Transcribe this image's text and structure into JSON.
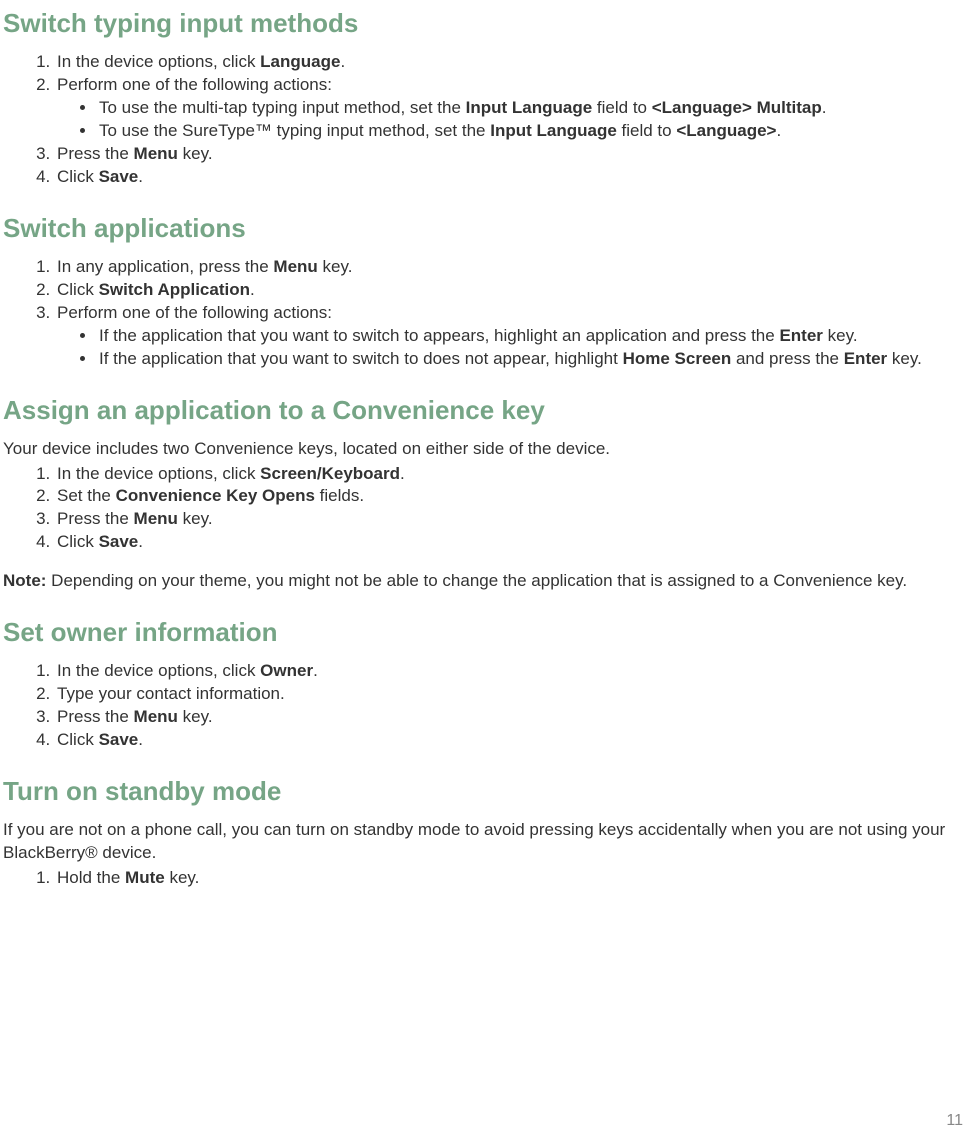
{
  "page_number": "11",
  "sections": {
    "s1": {
      "heading": "Switch typing input methods",
      "li1_a": "In the device options, click ",
      "li1_b": "Language",
      "li1_c": ".",
      "li2": "Perform one of the following actions:",
      "li2_sub1_a": "To use the multi-tap typing input method, set the ",
      "li2_sub1_b": "Input Language",
      "li2_sub1_c": " field to ",
      "li2_sub1_d": "<Language> Multitap",
      "li2_sub1_e": ".",
      "li2_sub2_a": "To use the SureType™ typing input method, set the ",
      "li2_sub2_b": "Input Language",
      "li2_sub2_c": " field to ",
      "li2_sub2_d": "<Language>",
      "li2_sub2_e": ".",
      "li3_a": "Press the ",
      "li3_b": "Menu",
      "li3_c": " key.",
      "li4_a": "Click ",
      "li4_b": "Save",
      "li4_c": "."
    },
    "s2": {
      "heading": "Switch applications",
      "li1_a": "In any application, press the ",
      "li1_b": "Menu",
      "li1_c": " key.",
      "li2_a": "Click ",
      "li2_b": "Switch Application",
      "li2_c": ".",
      "li3": "Perform one of the following actions:",
      "li3_sub1_a": "If the application that you want to switch to appears, highlight an application and press the ",
      "li3_sub1_b": "Enter",
      "li3_sub1_c": " key.",
      "li3_sub2_a": "If the application that you want to switch to does not appear, highlight ",
      "li3_sub2_b": "Home Screen",
      "li3_sub2_c": " and press the ",
      "li3_sub2_d": "Enter",
      "li3_sub2_e": " key."
    },
    "s3": {
      "heading": "Assign an application to a Convenience key",
      "intro": "Your device includes two Convenience keys, located on either side of the device.",
      "li1_a": "In the device options, click ",
      "li1_b": "Screen/Keyboard",
      "li1_c": ".",
      "li2_a": "Set the ",
      "li2_b": "Convenience Key Opens",
      "li2_c": " fields.",
      "li3_a": "Press the ",
      "li3_b": "Menu",
      "li3_c": " key.",
      "li4_a": "Click ",
      "li4_b": "Save",
      "li4_c": ".",
      "note_label": "Note:",
      "note_text": "  Depending on your theme, you might not be able to change the application that is assigned to a Convenience key."
    },
    "s4": {
      "heading": "Set owner information",
      "li1_a": "In the device options, click ",
      "li1_b": "Owner",
      "li1_c": ".",
      "li2": "Type your contact information.",
      "li3_a": "Press the ",
      "li3_b": "Menu",
      "li3_c": " key.",
      "li4_a": "Click ",
      "li4_b": "Save",
      "li4_c": "."
    },
    "s5": {
      "heading": "Turn on standby mode",
      "intro": "If you are not on a phone call, you can turn on standby mode to avoid pressing keys accidentally when you are not using your BlackBerry® device.",
      "li1_a": "Hold the ",
      "li1_b": "Mute",
      "li1_c": " key."
    }
  }
}
